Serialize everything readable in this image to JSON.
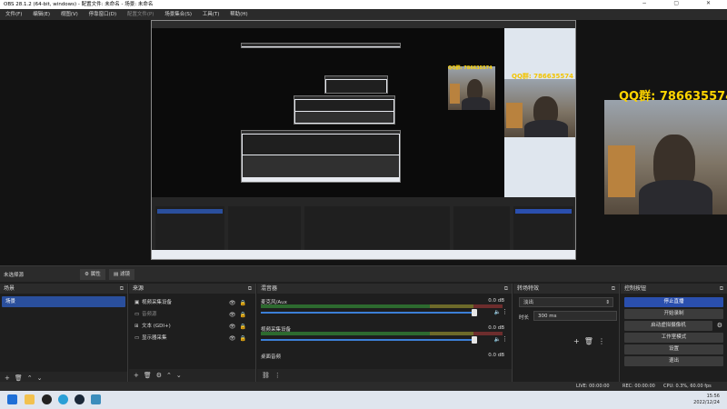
{
  "window": {
    "title": "OBS 28.1.2 (64-bit, windows) - 配置文件: 未命名 - 场景: 未命名"
  },
  "menu": [
    "文件(F)",
    "编辑(E)",
    "视图(V)",
    "停靠窗口(D)",
    "配置文件(P)",
    "场景集合(S)",
    "工具(T)",
    "帮助(H)"
  ],
  "overlay": {
    "qq_text": "QQ群: 786635574"
  },
  "source_bar": {
    "no_source": "未选择源",
    "props_label": "属性",
    "filter_label": "滤镜"
  },
  "panels": {
    "scenes": {
      "title": "场景",
      "items": [
        "场景"
      ]
    },
    "sources": {
      "title": "来源",
      "items": [
        {
          "icon": "camera-icon",
          "label": "视频采集设备"
        },
        {
          "icon": "folder-icon",
          "label": "音频源"
        },
        {
          "icon": "text-icon",
          "label": "文本 (GDI+)"
        },
        {
          "icon": "monitor-icon",
          "label": "显示器采集"
        }
      ]
    },
    "mixer": {
      "title": "混音器",
      "channels": [
        {
          "name": "麦克风/Aux",
          "db": "0.0 dB"
        },
        {
          "name": "视频采集设备",
          "db": "0.0 dB"
        },
        {
          "name": "桌面音频",
          "db": "0.0 dB"
        }
      ]
    },
    "transitions": {
      "title": "转场特效",
      "type": "淡出",
      "duration_label": "时长",
      "duration_value": "300 ms"
    },
    "controls": {
      "title": "控制按钮",
      "buttons": [
        "停止直播",
        "开始录制",
        "启动虚拟摄像机",
        "工作室模式",
        "设置",
        "退出"
      ]
    }
  },
  "status": {
    "live": "LIVE: 00:00:00",
    "rec": "REC: 00:00:00",
    "cpu": "CPU: 0.3%, 60.00 fps"
  },
  "clock": {
    "time": "15:56",
    "date": "2022/12/24"
  }
}
